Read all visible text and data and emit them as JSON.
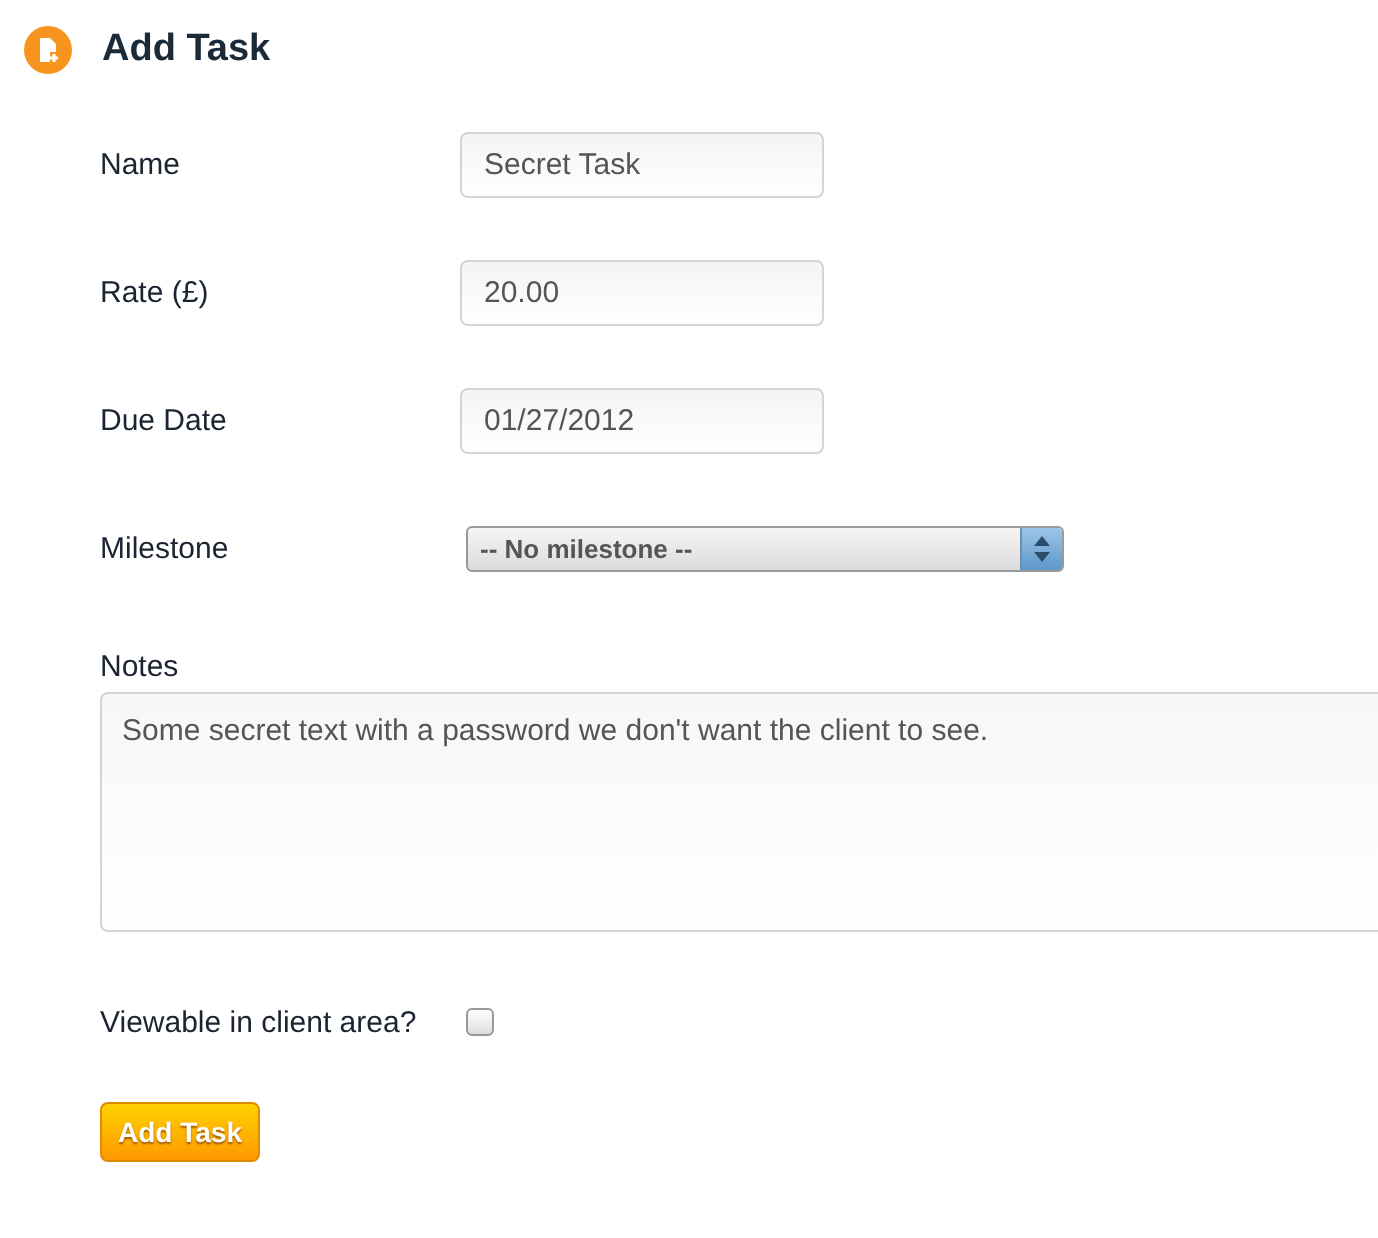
{
  "heading": {
    "title": "Add Task"
  },
  "fields": [
    {
      "kind": "text",
      "label": "Name",
      "value": "Secret Task"
    },
    {
      "kind": "text",
      "label": "Rate (£)",
      "value": "20.00"
    },
    {
      "kind": "text",
      "label": "Due Date",
      "value": "01/27/2012"
    },
    {
      "kind": "select",
      "label": "Milestone",
      "value": "-- No milestone --"
    }
  ],
  "notes": {
    "label": "Notes",
    "value": "Some secret text with a password we don't want the client to see."
  },
  "viewable": {
    "label": "Viewable in client area?",
    "checked": false
  },
  "submit": {
    "label": "Add Task"
  }
}
